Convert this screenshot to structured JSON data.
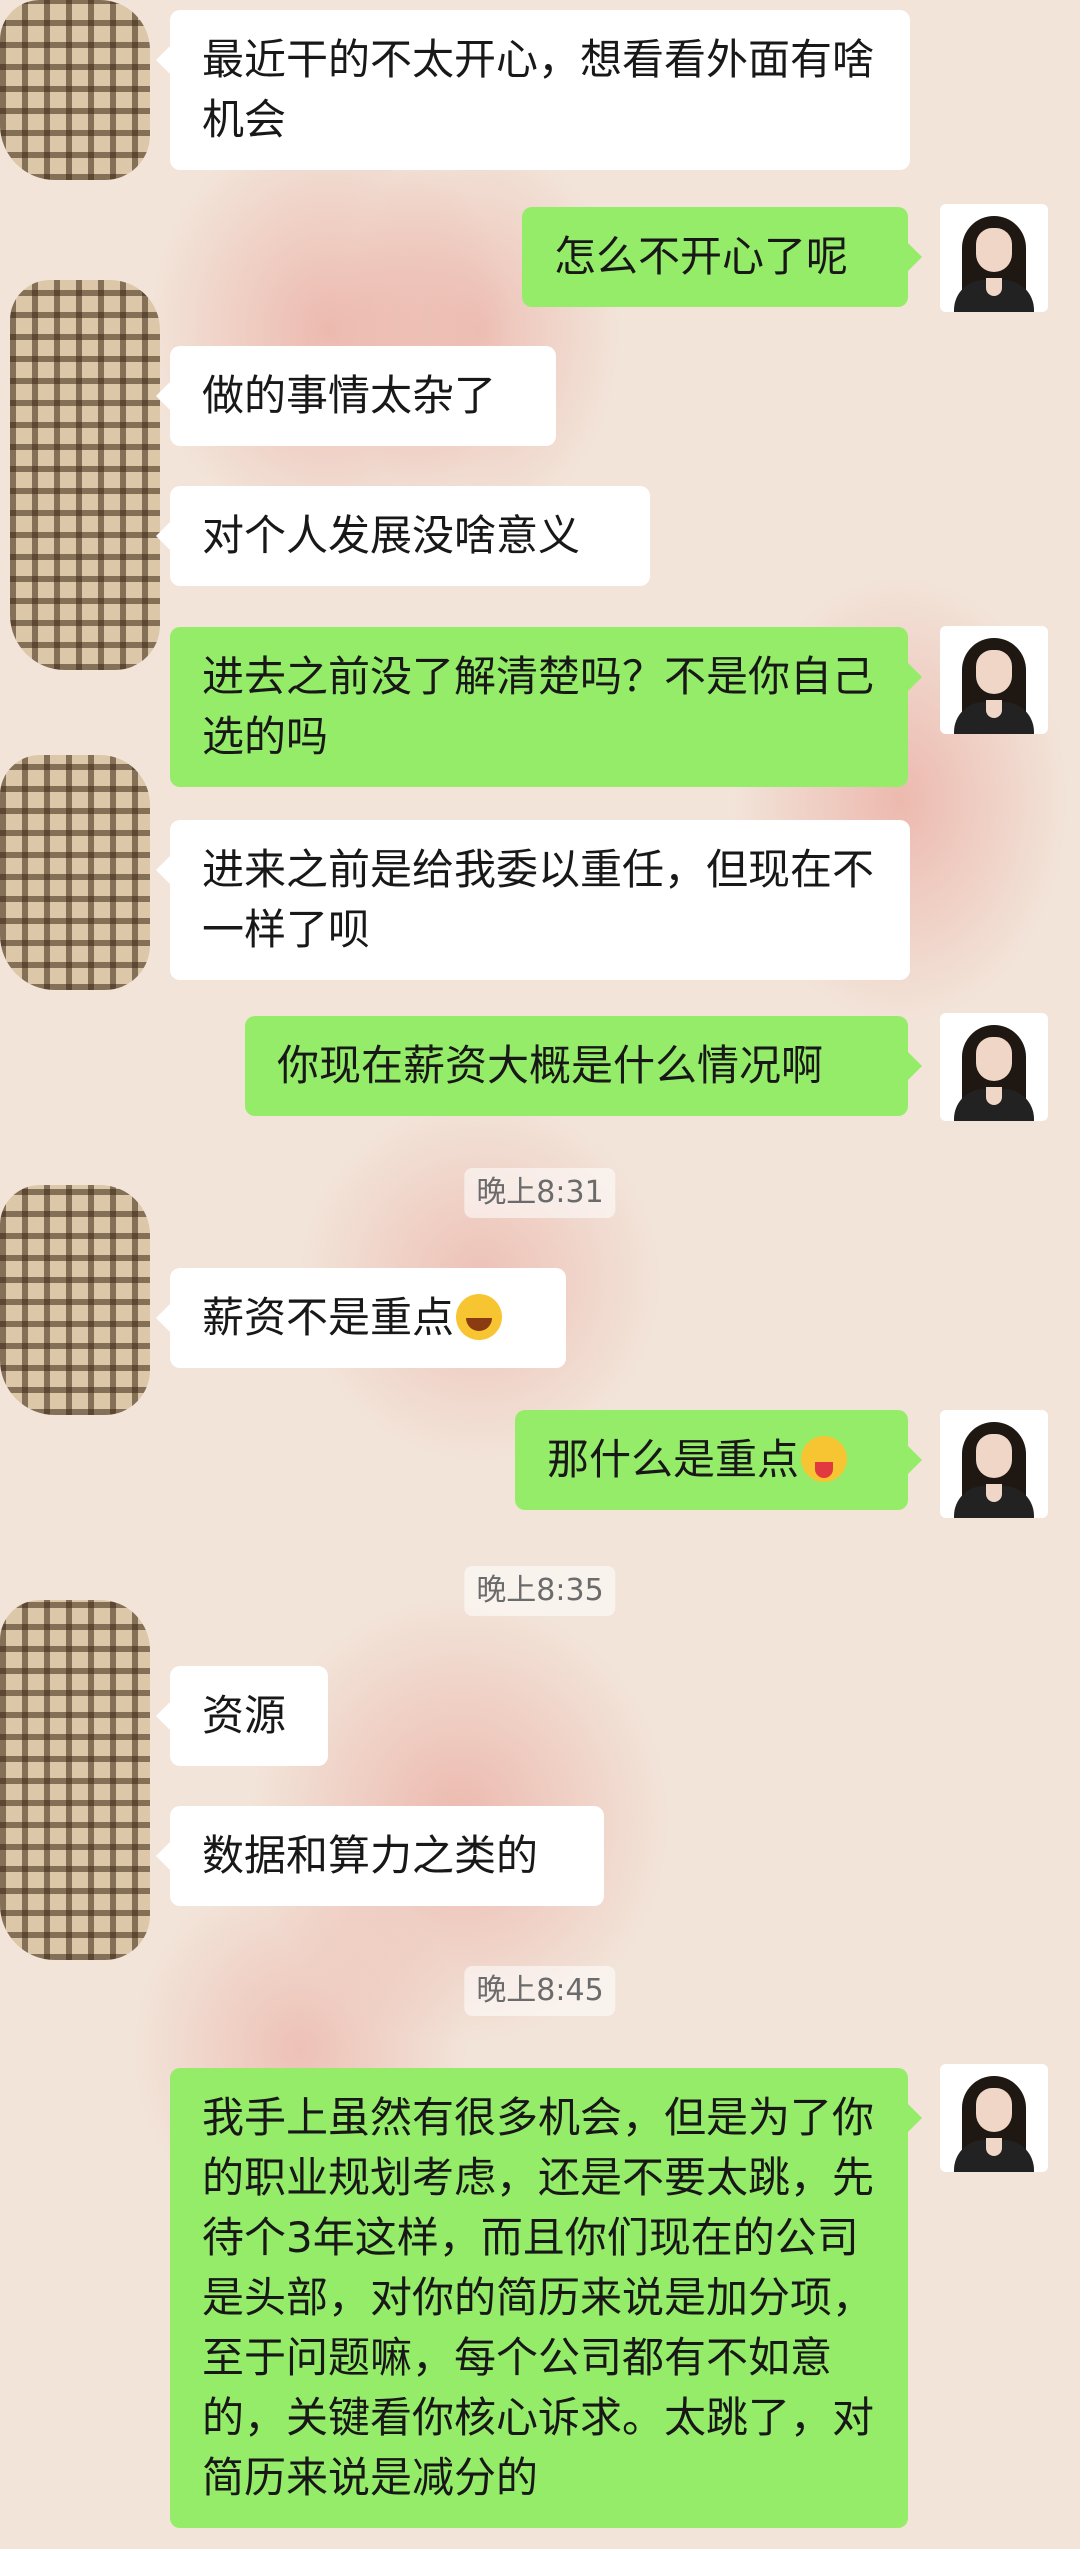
{
  "messages": [
    {
      "side": "in",
      "text": "最近干的不太开心，想看看外面有啥机会"
    },
    {
      "side": "out",
      "text": "怎么不开心了呢"
    },
    {
      "side": "in",
      "text": "做的事情太杂了"
    },
    {
      "side": "in",
      "text": "对个人发展没啥意义"
    },
    {
      "side": "out",
      "text": "进去之前没了解清楚吗？不是你自己选的吗"
    },
    {
      "side": "in",
      "text": "进来之前是给我委以重任，但现在不一样了呗"
    },
    {
      "side": "out",
      "text": "你现在薪资大概是什么情况啊"
    },
    {
      "side": "in",
      "text": "薪资不是重点",
      "emoji": "laughing-crying-emoji"
    },
    {
      "side": "out",
      "text": "那什么是重点",
      "emoji": "tongue-out-emoji"
    },
    {
      "side": "in",
      "text": "资源"
    },
    {
      "side": "in",
      "text": "数据和算力之类的"
    },
    {
      "side": "out",
      "text": "我手上虽然有很多机会，但是为了你的职业规划考虑，还是不要太跳，先待个3年这样，而且你们现在的公司是头部，对你的简历来说是加分项，至于问题嘛，每个公司都有不如意的，关键看你核心诉求。太跳了，对简历来说是减分的"
    }
  ],
  "timestamps": [
    "晚上8:31",
    "晚上8:35",
    "晚上8:45"
  ],
  "colors": {
    "incoming_bubble": "#ffffff",
    "outgoing_bubble": "#95ec69",
    "background": "#f2e4d9"
  }
}
